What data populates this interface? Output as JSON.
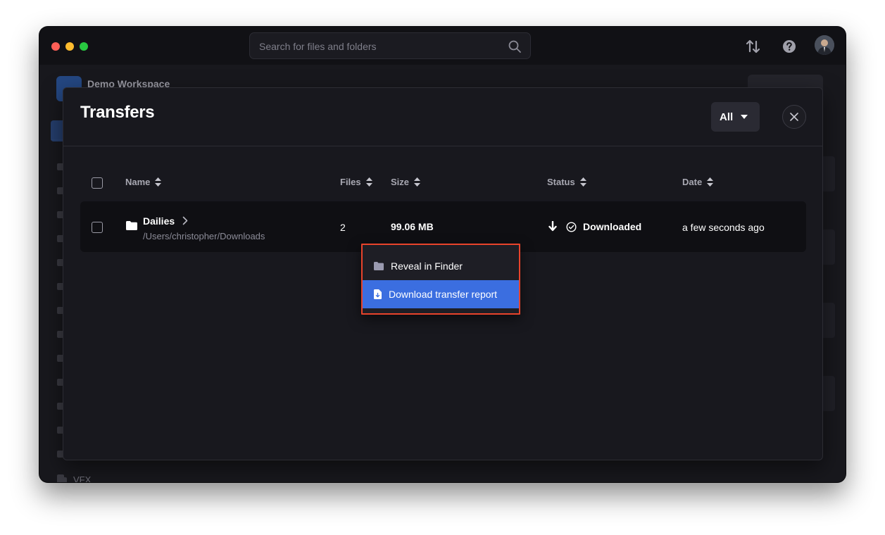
{
  "search": {
    "placeholder": "Search for files and folders"
  },
  "background": {
    "workspace_name": "Demo Workspace",
    "sidebar_last_item": "VFX"
  },
  "modal": {
    "title": "Transfers",
    "filter": {
      "selected": "All"
    }
  },
  "table": {
    "columns": [
      {
        "label": "Name"
      },
      {
        "label": "Files"
      },
      {
        "label": "Size"
      },
      {
        "label": "Status"
      },
      {
        "label": "Date"
      }
    ],
    "rows": [
      {
        "name": "Dailies",
        "path": "/Users/christopher/Downloads",
        "files": "2",
        "size": "99.06 MB",
        "status": "Downloaded",
        "date": "a few seconds ago"
      }
    ]
  },
  "context_menu": {
    "items": [
      {
        "label": "Reveal in Finder",
        "icon": "folder-icon"
      },
      {
        "label": "Download transfer report",
        "icon": "file-download-icon"
      }
    ]
  },
  "colors": {
    "accent": "#3b6ee0",
    "highlight_border": "#e8432b",
    "window_bg": "#18181d"
  }
}
